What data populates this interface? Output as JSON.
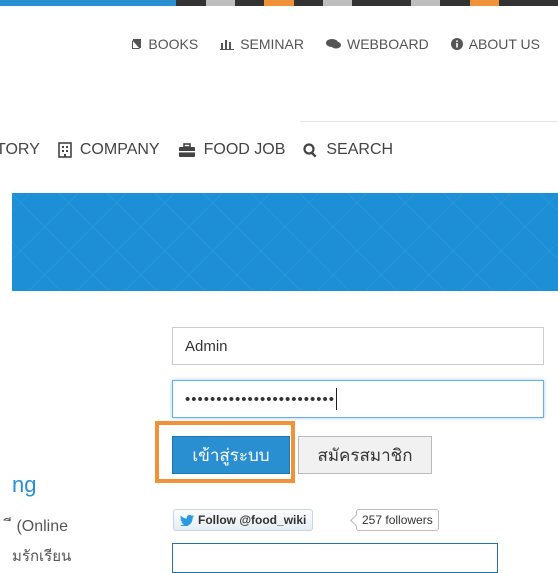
{
  "colors": {
    "stripe": [
      "#2a8fd0",
      "#2a8fd0",
      "#2a8fd0",
      "#2a8fd0",
      "#2a8fd0",
      "#2a8fd0",
      "#333333",
      "#bdbdbd",
      "#333333",
      "#f0923a",
      "#333333",
      "#bdbdbd",
      "#333333",
      "#333333",
      "#bdbdbd",
      "#333333",
      "#f0923a",
      "#333333",
      "#333333"
    ],
    "accent": "#2a8fd0",
    "highlight": "#f0923a"
  },
  "top_nav": {
    "items": [
      {
        "icon": "book-icon",
        "label": "BOOKS"
      },
      {
        "icon": "bar-chart-icon",
        "label": "SEMINAR"
      },
      {
        "icon": "comments-icon",
        "label": "WEBBOARD"
      },
      {
        "icon": "info-circle-icon",
        "label": "ABOUT US"
      }
    ]
  },
  "main_nav": {
    "items": [
      {
        "icon": "",
        "label": "TORY"
      },
      {
        "icon": "building-icon",
        "label": "COMPANY"
      },
      {
        "icon": "briefcase-icon",
        "label": "FOOD JOB"
      },
      {
        "icon": "search-icon",
        "label": "SEARCH"
      }
    ]
  },
  "login": {
    "username": "Admin",
    "password_mask": "••••••••••••••••••••••••",
    "login_label": "เข้าสู่ระบบ",
    "register_label": "สมัครสมาชิก"
  },
  "sidebar": {
    "heading": "ng",
    "line1": "ี (Online",
    "line2": "มรักเรียน"
  },
  "twitter": {
    "follow_label": "Follow @food_wiki",
    "followers_label": "257 followers"
  }
}
